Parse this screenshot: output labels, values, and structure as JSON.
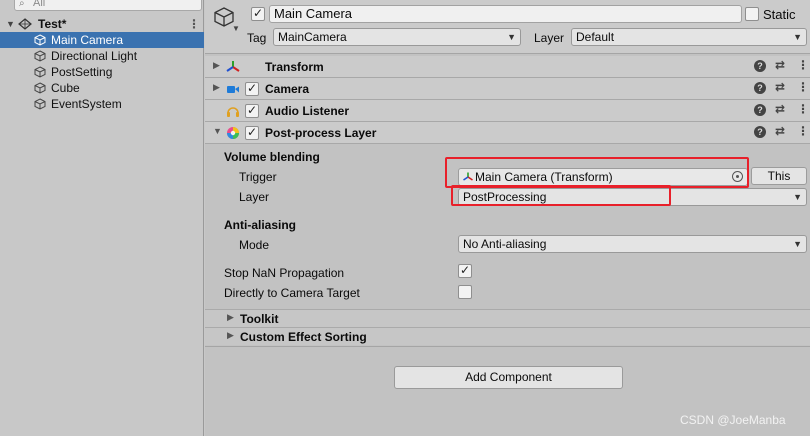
{
  "hierarchy": {
    "search_placeholder": "All",
    "scene": {
      "name": "Test*",
      "menu_glyph": "⋮"
    },
    "items": [
      {
        "label": "Main Camera",
        "selected": true
      },
      {
        "label": "Directional Light",
        "selected": false
      },
      {
        "label": "PostSetting",
        "selected": false
      },
      {
        "label": "Cube",
        "selected": false
      },
      {
        "label": "EventSystem",
        "selected": false
      }
    ]
  },
  "inspector": {
    "object_name": "Main Camera",
    "active_checked": true,
    "static_label": "Static",
    "static_checked": false,
    "tag_label": "Tag",
    "tag_value": "MainCamera",
    "layer_label": "Layer",
    "layer_value": "Default",
    "components": [
      {
        "title": "Transform",
        "icon": "transform-icon",
        "has_checkbox": false
      },
      {
        "title": "Camera",
        "icon": "camera-icon",
        "has_checkbox": true
      },
      {
        "title": "Audio Listener",
        "icon": "headphones-icon",
        "has_checkbox": true
      },
      {
        "title": "Post-process Layer",
        "icon": "postprocess-icon",
        "has_checkbox": true
      }
    ],
    "post_process": {
      "volume_blending_header": "Volume blending",
      "trigger_label": "Trigger",
      "trigger_value": "Main Camera (Transform)",
      "this_button": "This",
      "layer_label": "Layer",
      "layer_value": "PostProcessing",
      "anti_aliasing_header": "Anti-aliasing",
      "mode_label": "Mode",
      "mode_value": "No Anti-aliasing",
      "stop_nan_label": "Stop NaN Propagation",
      "stop_nan_checked": true,
      "direct_label": "Directly to Camera Target",
      "direct_checked": false,
      "toolkit_label": "Toolkit",
      "custom_sorting_label": "Custom Effect Sorting"
    },
    "add_component": "Add Component"
  },
  "watermark": "CSDN @JoeManba",
  "colors": {
    "selection": "#3a72b0",
    "highlight": "#e8202a"
  }
}
